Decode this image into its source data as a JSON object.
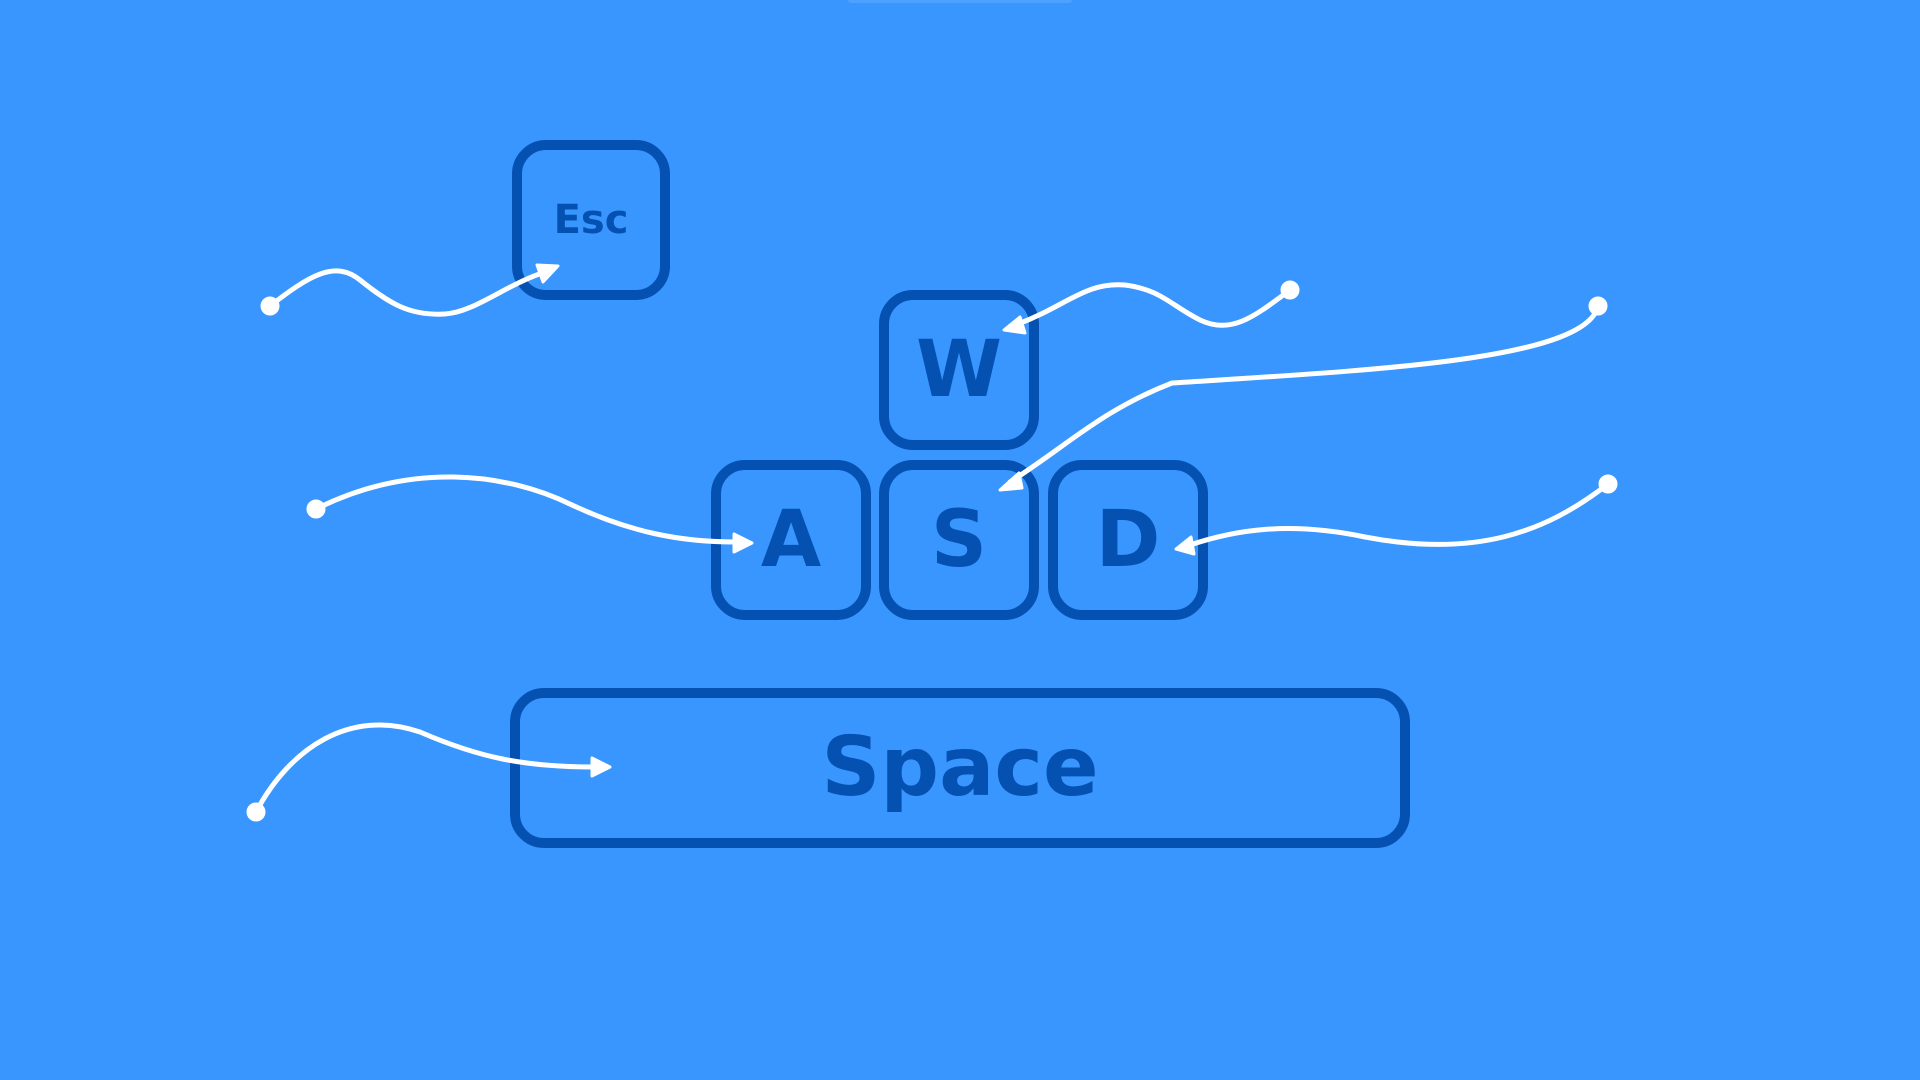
{
  "theme": {
    "background": "#3996FE",
    "key_color": "#0551B1",
    "arrow_color": "#FFFFFF"
  },
  "keys": {
    "esc": "Esc",
    "w": "W",
    "a": "A",
    "s": "S",
    "d": "D",
    "space": "Space"
  }
}
